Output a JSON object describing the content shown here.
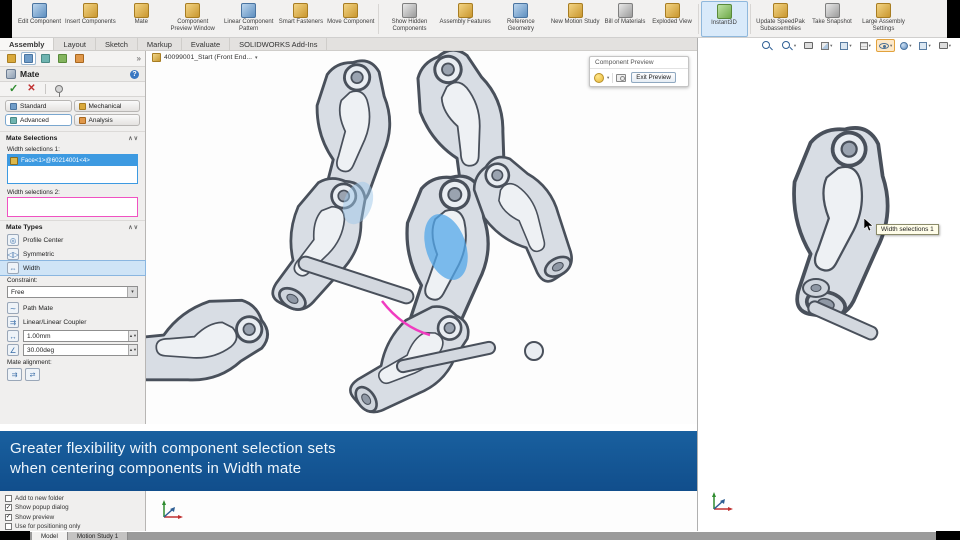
{
  "ribbon": {
    "buttons": [
      "Edit Component",
      "Insert Components",
      "Mate",
      "Component Preview Window",
      "Linear Component Pattern",
      "Smart Fasteners",
      "Move Component",
      "Show Hidden Components",
      "Assembly Features",
      "Reference Geometry",
      "New Motion Study",
      "Bill of Materials",
      "Exploded View",
      "Instant3D",
      "Update SpeedPak Subassemblies",
      "Take Snapshot",
      "Large Assembly Settings"
    ],
    "active": "Instant3D"
  },
  "tabbar": {
    "tabs": [
      "Assembly",
      "Layout",
      "Sketch",
      "Markup",
      "Evaluate",
      "SOLIDWORKS Add-Ins"
    ],
    "active": "Assembly"
  },
  "pm": {
    "title": "Mate",
    "tab_standard": "Standard",
    "tab_mechanical": "Mechanical",
    "tab_advanced": "Advanced",
    "tab_analysis": "Analysis",
    "mate_selections_title": "Mate Selections",
    "width_sel1_label": "Width selections 1:",
    "width_sel1_value": "Face<1>@60214001<4>",
    "width_sel2_label": "Width selections 2:",
    "mate_types_title": "Mate Types",
    "profile_center": "Profile Center",
    "symmetric": "Symmetric",
    "width": "Width",
    "constraint_label": "Constraint:",
    "constraint_value": "Free",
    "path_mate": "Path Mate",
    "linear_coupler": "Linear/Linear Coupler",
    "distance": "1.00mm",
    "angle": "30.00deg",
    "mate_alignment_label": "Mate alignment:",
    "options": [
      {
        "label": "Add to new folder",
        "checked": false
      },
      {
        "label": "Show popup dialog",
        "checked": true
      },
      {
        "label": "Show preview",
        "checked": true
      },
      {
        "label": "Use for positioning only",
        "checked": false
      }
    ]
  },
  "viewport": {
    "doc_tab": "40099001_Start (Front End...",
    "preview_title": "Component Preview",
    "exit_preview": "Exit Preview"
  },
  "preview": {
    "tooltip": "Width selections 1"
  },
  "banner": {
    "line1": "Greater flexibility with component selection sets",
    "line2": "when centering components in Width mate"
  },
  "statusbar": {
    "tabs": [
      "Model",
      "Motion Study 1"
    ],
    "active": "Model"
  },
  "colors": {
    "banner_blue": "#155a9e",
    "selection_blue": "#3d9ae1",
    "highlight_pink": "#f052c2",
    "active_ribbon": "#d9eafa"
  },
  "glyphs": {
    "check": "✓",
    "cancel": "✕",
    "dropdown": "▾",
    "collapse": "∧∨",
    "expand": "»",
    "help": "?",
    "profile_center": "◎",
    "symmetric": "◁▷",
    "width": "⇔",
    "path_mate": "∼",
    "linear_coupler": "⇉",
    "distance": "↔",
    "angle": "∠",
    "align_same": "⇉",
    "align_opposite": "⇄"
  }
}
